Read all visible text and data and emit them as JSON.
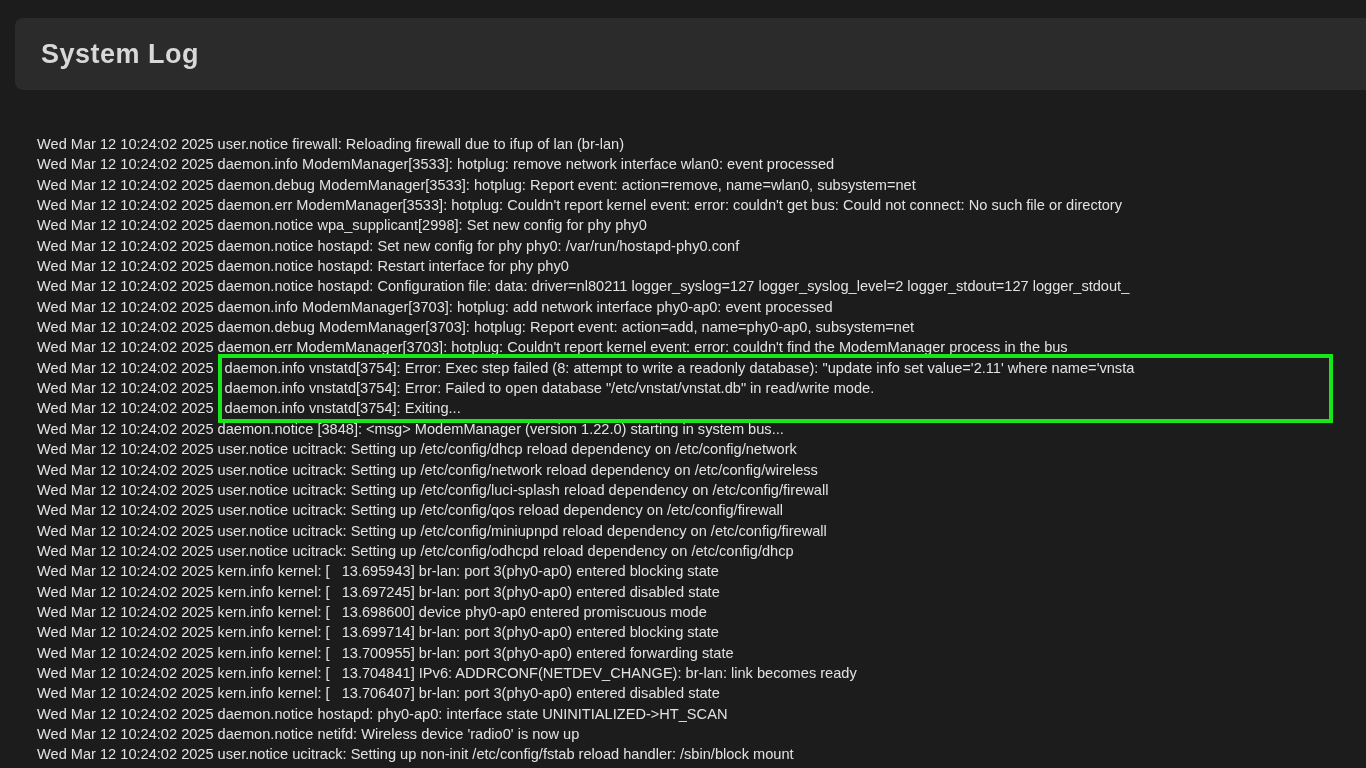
{
  "header": {
    "title": "System Log"
  },
  "log": [
    {
      "time": "Wed Mar 12 10:24:02 2025",
      "message": "user.notice firewall: Reloading firewall due to ifup of lan (br-lan)",
      "highlighted": false
    },
    {
      "time": "Wed Mar 12 10:24:02 2025",
      "message": "daemon.info ModemManager[3533]: hotplug: remove network interface wlan0: event processed",
      "highlighted": false
    },
    {
      "time": "Wed Mar 12 10:24:02 2025",
      "message": "daemon.debug ModemManager[3533]: hotplug: Report event: action=remove, name=wlan0, subsystem=net",
      "highlighted": false
    },
    {
      "time": "Wed Mar 12 10:24:02 2025",
      "message": "daemon.err ModemManager[3533]: hotplug: Couldn't report kernel event: error: couldn't get bus: Could not connect: No such file or directory",
      "highlighted": false
    },
    {
      "time": "Wed Mar 12 10:24:02 2025",
      "message": "daemon.notice wpa_supplicant[2998]: Set new config for phy phy0",
      "highlighted": false
    },
    {
      "time": "Wed Mar 12 10:24:02 2025",
      "message": "daemon.notice hostapd: Set new config for phy phy0: /var/run/hostapd-phy0.conf",
      "highlighted": false
    },
    {
      "time": "Wed Mar 12 10:24:02 2025",
      "message": "daemon.notice hostapd: Restart interface for phy phy0",
      "highlighted": false
    },
    {
      "time": "Wed Mar 12 10:24:02 2025",
      "message": "daemon.notice hostapd: Configuration file: data: driver=nl80211 logger_syslog=127 logger_syslog_level=2 logger_stdout=127 logger_stdout_",
      "highlighted": false
    },
    {
      "time": "Wed Mar 12 10:24:02 2025",
      "message": "daemon.info ModemManager[3703]: hotplug: add network interface phy0-ap0: event processed",
      "highlighted": false
    },
    {
      "time": "Wed Mar 12 10:24:02 2025",
      "message": "daemon.debug ModemManager[3703]: hotplug: Report event: action=add, name=phy0-ap0, subsystem=net",
      "highlighted": false
    },
    {
      "time": "Wed Mar 12 10:24:02 2025",
      "message": "daemon.err ModemManager[3703]: hotplug: Couldn't report kernel event: error: couldn't find the ModemManager process in the bus",
      "highlighted": false
    },
    {
      "time": "Wed Mar 12 10:24:02 2025",
      "message": "daemon.info vnstatd[3754]: Error: Exec step failed (8: attempt to write a readonly database): \"update info set value='2.11' where name='vnsta",
      "highlighted": true
    },
    {
      "time": "Wed Mar 12 10:24:02 2025",
      "message": "daemon.info vnstatd[3754]: Error: Failed to open database \"/etc/vnstat/vnstat.db\" in read/write mode.",
      "highlighted": true
    },
    {
      "time": "Wed Mar 12 10:24:02 2025",
      "message": "daemon.info vnstatd[3754]: Exiting...",
      "highlighted": true
    },
    {
      "time": "Wed Mar 12 10:24:02 2025",
      "message": "daemon.notice [3848]: <msg> ModemManager (version 1.22.0) starting in system bus...",
      "highlighted": false
    },
    {
      "time": "Wed Mar 12 10:24:02 2025",
      "message": "user.notice ucitrack: Setting up /etc/config/dhcp reload dependency on /etc/config/network",
      "highlighted": false
    },
    {
      "time": "Wed Mar 12 10:24:02 2025",
      "message": "user.notice ucitrack: Setting up /etc/config/network reload dependency on /etc/config/wireless",
      "highlighted": false
    },
    {
      "time": "Wed Mar 12 10:24:02 2025",
      "message": "user.notice ucitrack: Setting up /etc/config/luci-splash reload dependency on /etc/config/firewall",
      "highlighted": false
    },
    {
      "time": "Wed Mar 12 10:24:02 2025",
      "message": "user.notice ucitrack: Setting up /etc/config/qos reload dependency on /etc/config/firewall",
      "highlighted": false
    },
    {
      "time": "Wed Mar 12 10:24:02 2025",
      "message": "user.notice ucitrack: Setting up /etc/config/miniupnpd reload dependency on /etc/config/firewall",
      "highlighted": false
    },
    {
      "time": "Wed Mar 12 10:24:02 2025",
      "message": "user.notice ucitrack: Setting up /etc/config/odhcpd reload dependency on /etc/config/dhcp",
      "highlighted": false
    },
    {
      "time": "Wed Mar 12 10:24:02 2025",
      "message": "kern.info kernel: [   13.695943] br-lan: port 3(phy0-ap0) entered blocking state",
      "highlighted": false
    },
    {
      "time": "Wed Mar 12 10:24:02 2025",
      "message": "kern.info kernel: [   13.697245] br-lan: port 3(phy0-ap0) entered disabled state",
      "highlighted": false
    },
    {
      "time": "Wed Mar 12 10:24:02 2025",
      "message": "kern.info kernel: [   13.698600] device phy0-ap0 entered promiscuous mode",
      "highlighted": false
    },
    {
      "time": "Wed Mar 12 10:24:02 2025",
      "message": "kern.info kernel: [   13.699714] br-lan: port 3(phy0-ap0) entered blocking state",
      "highlighted": false
    },
    {
      "time": "Wed Mar 12 10:24:02 2025",
      "message": "kern.info kernel: [   13.700955] br-lan: port 3(phy0-ap0) entered forwarding state",
      "highlighted": false
    },
    {
      "time": "Wed Mar 12 10:24:02 2025",
      "message": "kern.info kernel: [   13.704841] IPv6: ADDRCONF(NETDEV_CHANGE): br-lan: link becomes ready",
      "highlighted": false
    },
    {
      "time": "Wed Mar 12 10:24:02 2025",
      "message": "kern.info kernel: [   13.706407] br-lan: port 3(phy0-ap0) entered disabled state",
      "highlighted": false
    },
    {
      "time": "Wed Mar 12 10:24:02 2025",
      "message": "daemon.notice hostapd: phy0-ap0: interface state UNINITIALIZED->HT_SCAN",
      "highlighted": false
    },
    {
      "time": "Wed Mar 12 10:24:02 2025",
      "message": "daemon.notice netifd: Wireless device 'radio0' is now up",
      "highlighted": false
    },
    {
      "time": "Wed Mar 12 10:24:02 2025",
      "message": "user.notice ucitrack: Setting up non-init /etc/config/fstab reload handler: /sbin/block mount",
      "highlighted": false
    }
  ]
}
